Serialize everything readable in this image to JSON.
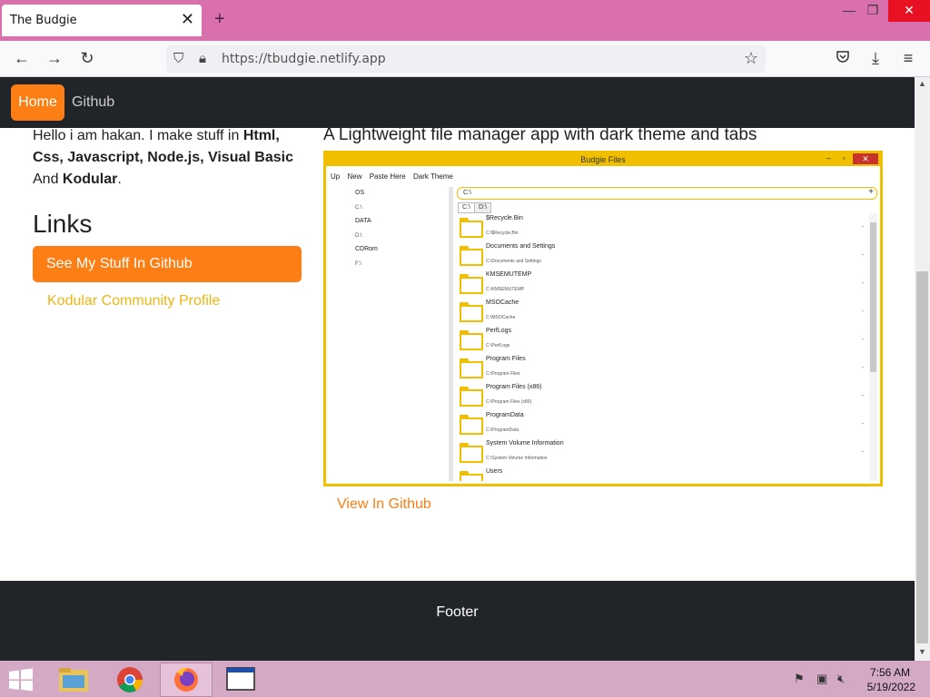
{
  "browser": {
    "tab_title": "The Budgie",
    "tab_close": "✕",
    "new_tab": "+",
    "url": "https://tbudgie.netlify.app",
    "window_controls": {
      "minimize": "—",
      "restore": "❐",
      "close": "✕"
    }
  },
  "site": {
    "nav": {
      "home": "Home",
      "github": "Github"
    },
    "intro": {
      "prefix": "Hello i am hakan. I make stuff in ",
      "skills": "Html, Css, Javascript, Node.js, Visual Basic",
      "and": "And",
      "last": "Kodular",
      "period": "."
    },
    "links_heading": "Links",
    "github_button": "See My Stuff In Github",
    "kodular_link": "Kodular Community Profile",
    "project": {
      "title": "A Lightweight file manager app with dark theme and tabs",
      "view_link": "View In Github"
    },
    "footer": "Footer"
  },
  "budgie_app": {
    "window_title": "Budgie Files",
    "menu": [
      "Up",
      "New",
      "Paste Here",
      "Dark Theme"
    ],
    "drives": [
      {
        "label": "OS",
        "path": "C:\\"
      },
      {
        "label": "DATA",
        "path": "D:\\"
      },
      {
        "label": "CDRom",
        "path": "F:\\"
      }
    ],
    "path_value": "C:\\",
    "tabs": [
      "C:\\",
      "D:\\"
    ],
    "items": [
      {
        "name": "$Recycle.Bin",
        "path": "C:\\$Recycle.Bin"
      },
      {
        "name": "Documents and Settings",
        "path": "C:\\Documents and Settings"
      },
      {
        "name": "KMSEMUTEMP",
        "path": "C:\\KMSEMUTEMP"
      },
      {
        "name": "MSOCache",
        "path": "C:\\MSOCache"
      },
      {
        "name": "PerfLogs",
        "path": "C:\\PerfLogs"
      },
      {
        "name": "Program Files",
        "path": "C:\\Program Files"
      },
      {
        "name": "Program Files (x86)",
        "path": "C:\\Program Files (x86)"
      },
      {
        "name": "ProgramData",
        "path": "C:\\ProgramData"
      },
      {
        "name": "System Volume Information",
        "path": "C:\\System Volume Information"
      },
      {
        "name": "Users",
        "path": ""
      }
    ]
  },
  "taskbar": {
    "time": "7:56 AM",
    "date": "5/19/2022"
  },
  "colors": {
    "accent_orange": "#fd7e14",
    "accent_yellow": "#f0c000",
    "dark": "#212529"
  }
}
